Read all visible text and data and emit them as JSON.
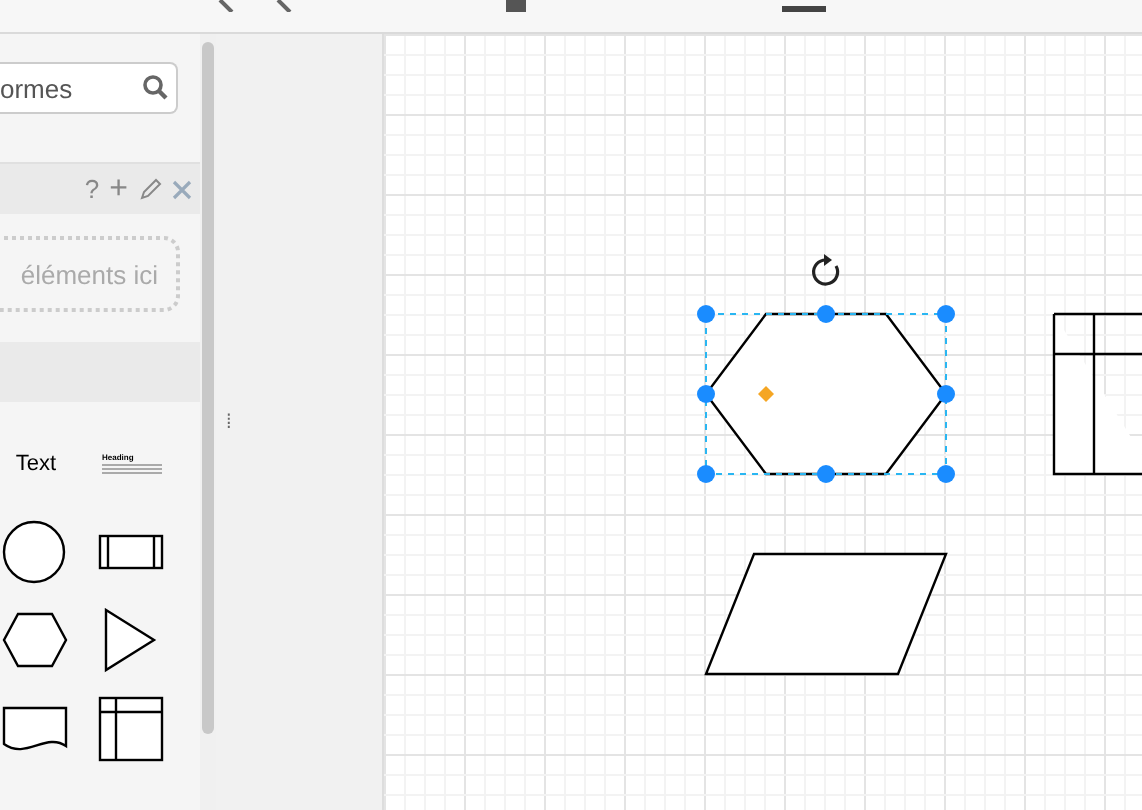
{
  "sidebar": {
    "search": {
      "placeholder": "ormes"
    },
    "palette_header": {
      "help": "?",
      "add": "+"
    },
    "drop_zone": {
      "text": "éléments ici"
    },
    "shapes": [
      {
        "kind": "text",
        "label": "Text"
      },
      {
        "kind": "heading",
        "label": "Heading"
      },
      {
        "kind": "ellipse"
      },
      {
        "kind": "process"
      },
      {
        "kind": "hexagon"
      },
      {
        "kind": "triangle"
      },
      {
        "kind": "document"
      },
      {
        "kind": "storage"
      }
    ]
  },
  "divider": {
    "handle": "⁞"
  },
  "canvas": {
    "shapes": [
      {
        "kind": "hexagon",
        "selected": true
      },
      {
        "kind": "table",
        "selected": false
      },
      {
        "kind": "parallelogram",
        "selected": false
      }
    ]
  }
}
